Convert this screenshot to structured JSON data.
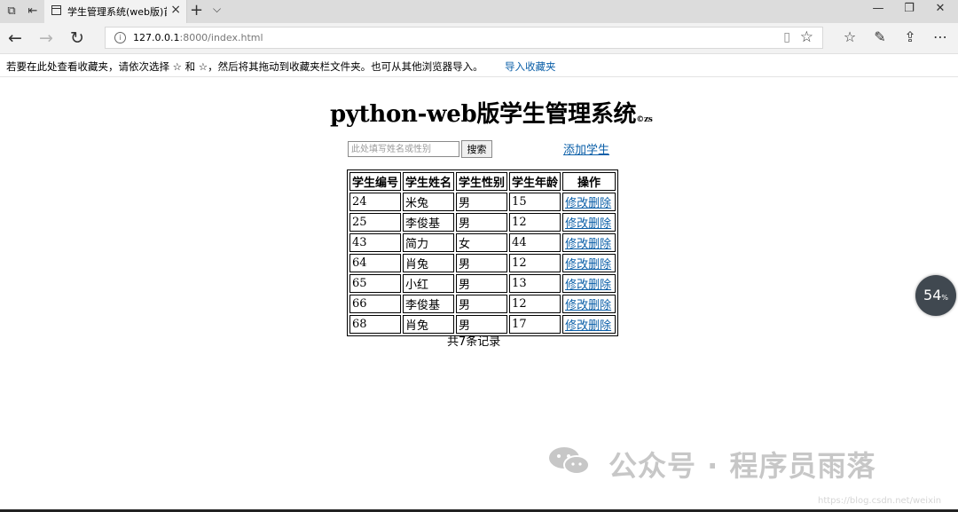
{
  "browser": {
    "tab_title": "学生管理系统(web版)首",
    "new_tab_symbol": "+",
    "url_host": "127.0.0.1",
    "url_rest": ":8000/index.html",
    "favorites_message": "若要在此处查看收藏夹，请依次选择 ☆ 和 ☆，然后将其拖动到收藏夹栏文件夹。也可从其他浏览器导入。",
    "import_favorites_label": "导入收藏夹"
  },
  "page": {
    "title": "python-web版学生管理系统",
    "title_suffix": "©zs",
    "search_placeholder": "此处填写姓名或性别",
    "search_button": "搜索",
    "add_student_label": "添加学生",
    "table": {
      "headers": [
        "学生编号",
        "学生姓名",
        "学生性别",
        "学生年龄",
        "操作"
      ],
      "rows": [
        [
          "24",
          "米兔",
          "男",
          "15"
        ],
        [
          "25",
          "李俊基",
          "男",
          "12"
        ],
        [
          "43",
          "简力",
          "女",
          "44"
        ],
        [
          "64",
          "肖兔",
          "男",
          "12"
        ],
        [
          "65",
          "小红",
          "男",
          "13"
        ],
        [
          "66",
          "李俊基",
          "男",
          "12"
        ],
        [
          "68",
          "肖兔",
          "男",
          "17"
        ]
      ],
      "edit_label": "修改",
      "delete_label": "删除"
    },
    "record_count": "共7条记录"
  },
  "overlay": {
    "gauge_value": "54",
    "gauge_unit": "%",
    "watermark_text": "公众号 · 程序员雨落",
    "csdn_text": "https://blog.csdn.net/weixin"
  }
}
